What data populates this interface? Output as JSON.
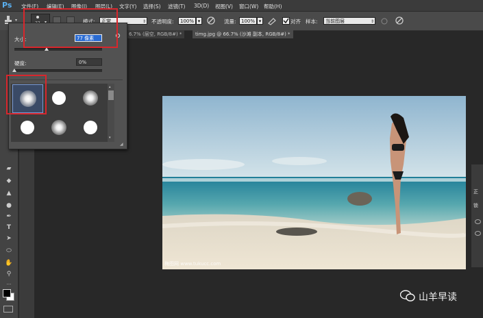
{
  "app": {
    "logo": "Ps"
  },
  "menu": [
    "文件(F)",
    "编辑(E)",
    "图像(I)",
    "图层(L)",
    "文字(Y)",
    "选择(S)",
    "滤镜(T)",
    "3D(D)",
    "视图(V)",
    "窗口(W)",
    "帮助(H)"
  ],
  "options": {
    "brush_size_badge": "77",
    "mode_label": "模式:",
    "mode_value": "正常",
    "opacity_label": "不透明度:",
    "opacity_value": "100%",
    "flow_label": "流量:",
    "flow_value": "100%",
    "align_label": "对齐",
    "sample_label": "样本:",
    "sample_value": "当前图层"
  },
  "tabs": [
    "6.7% (层空, RGB/8#) *",
    "timg.jpg @ 66.7% (沙滩 副本, RGB/8#) *"
  ],
  "brush_panel": {
    "size_label": "大小:",
    "size_value": "77 像素",
    "hardness_label": "硬度:",
    "hardness_value": "0%",
    "size_fraction": 0.37,
    "hardness_fraction": 0.0
  },
  "right_panel": [
    "正",
    "锁"
  ],
  "watermark": "山羊早读",
  "photo_caption": "梅图网 www.tukucc.com",
  "colors": {
    "highlight_red": "#d9262c",
    "foreground": "#000000",
    "background": "#ffffff"
  }
}
